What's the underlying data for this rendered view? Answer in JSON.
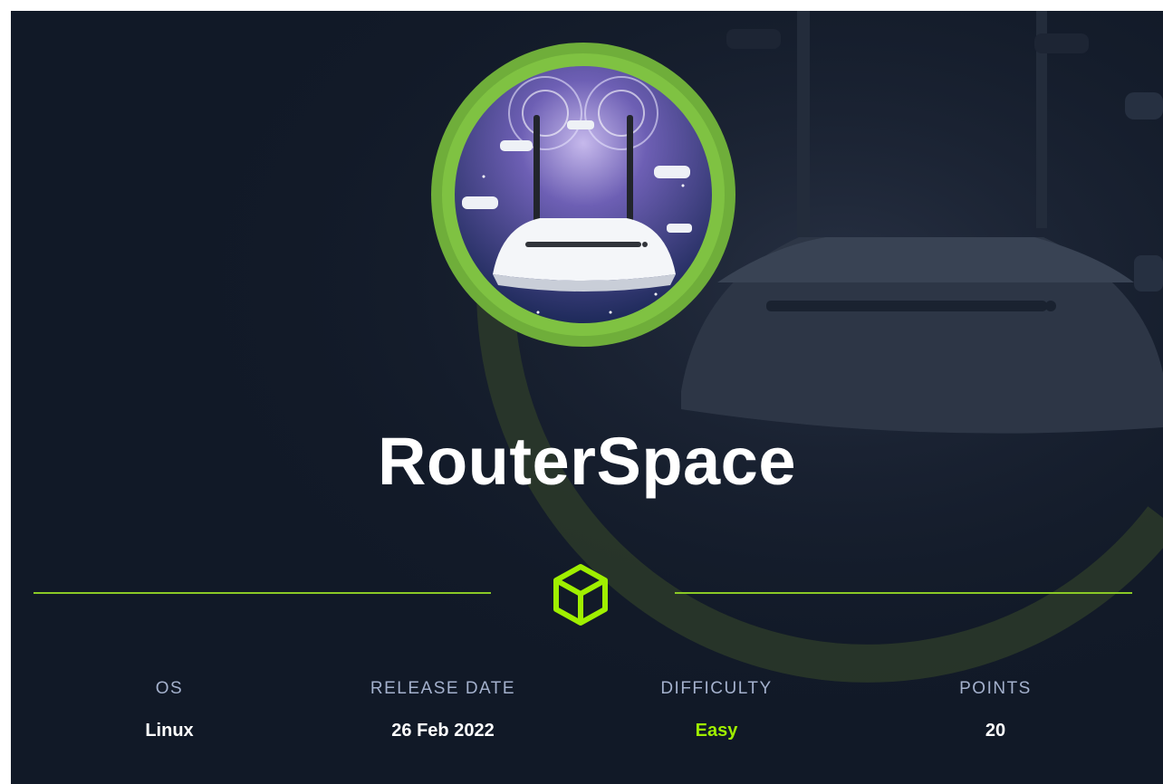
{
  "machine": {
    "name": "RouterSpace",
    "icon": "box-icon",
    "avatar_icon": "wireless-router-icon"
  },
  "stats": [
    {
      "label": "OS",
      "value": "Linux"
    },
    {
      "label": "RELEASE DATE",
      "value": "26 Feb 2022"
    },
    {
      "label": "DIFFICULTY",
      "value": "Easy"
    },
    {
      "label": "POINTS",
      "value": "20"
    }
  ],
  "colors": {
    "background": "#111927",
    "accent_green": "#9fef00",
    "ring_green": "#76be3c",
    "label_gray": "#a4b1cd",
    "text_white": "#ffffff"
  }
}
